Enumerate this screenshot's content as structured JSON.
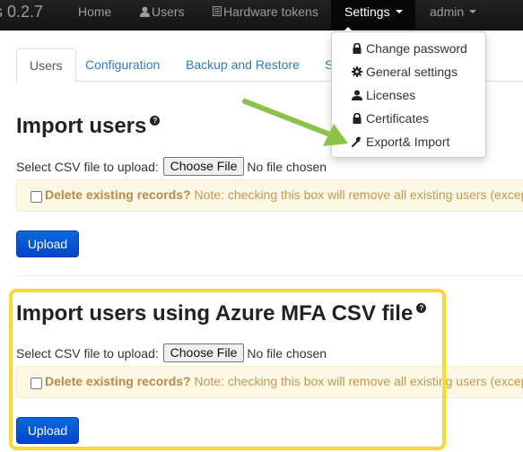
{
  "navbar": {
    "brand": "s 0.2.7",
    "items": [
      {
        "label": "Home",
        "icon": null
      },
      {
        "label": "Users",
        "icon": "user-icon"
      },
      {
        "label": "Hardware tokens",
        "icon": "list-icon"
      },
      {
        "label": "Settings",
        "icon": null,
        "dropdown": true,
        "active": true
      },
      {
        "label": "admin",
        "icon": null,
        "dropdown": true
      }
    ]
  },
  "settings_menu": {
    "items": [
      {
        "label": "Change password",
        "icon": "lock-icon"
      },
      {
        "label": "General settings",
        "icon": "gear-icon"
      },
      {
        "label": "Licenses",
        "icon": "user-icon"
      },
      {
        "label": "Certificates",
        "icon": "lock-icon"
      },
      {
        "label": "Export& Import",
        "icon": "wrench-icon"
      }
    ]
  },
  "tabs": [
    {
      "label": "Users",
      "active": true
    },
    {
      "label": "Configuration"
    },
    {
      "label": "Backup and Restore"
    },
    {
      "label": "S"
    }
  ],
  "sections": [
    {
      "title": "Import users",
      "help_icon": "?",
      "file_label": "Select CSV file to upload:",
      "choose_button": "Choose File",
      "file_status": "No file chosen",
      "delete_label": "Delete existing records?",
      "delete_note": "Note: checking this box will remove all existing users (excep",
      "delete_checked": false,
      "upload_button": "Upload"
    },
    {
      "title": "Import users using Azure MFA CSV file",
      "help_icon": "?",
      "file_label": "Select CSV file to upload:",
      "choose_button": "Choose File",
      "file_status": "No file chosen",
      "delete_label": "Delete existing records?",
      "delete_note": "Note: checking this box will remove all existing users (excep",
      "delete_checked": false,
      "upload_button": "Upload"
    }
  ],
  "annotations": {
    "arrow_color": "#8bc34a",
    "highlight_color": "#fdd835"
  }
}
